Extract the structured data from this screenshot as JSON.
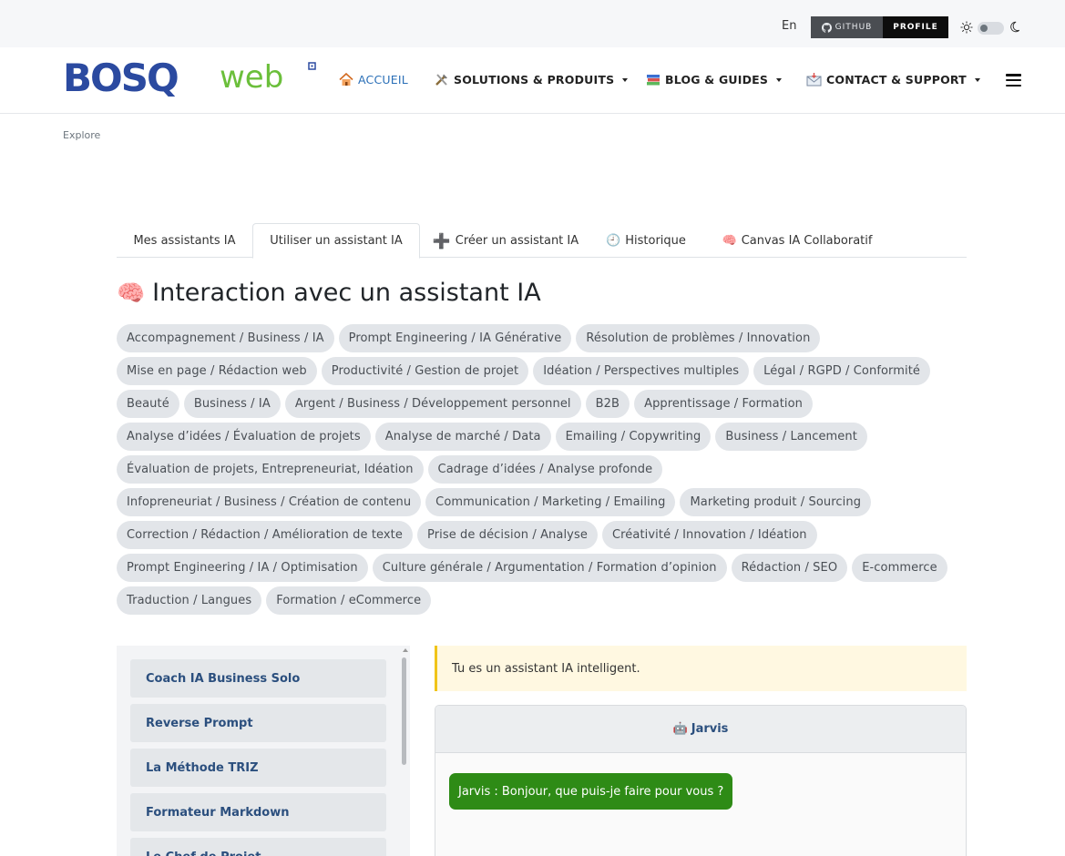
{
  "topbar": {
    "language": "En",
    "github_label": "GITHUB",
    "profile_label": "PROFILE"
  },
  "logo": {
    "text_left": "BOSQ",
    "text_right": "web"
  },
  "nav": {
    "items": [
      {
        "label": "ACCUEIL",
        "icon": "house-icon"
      },
      {
        "label": "SOLUTIONS & PRODUITS",
        "icon": "tools-icon"
      },
      {
        "label": "BLOG & GUIDES",
        "icon": "books-icon"
      },
      {
        "label": "CONTACT & SUPPORT",
        "icon": "envelope-icon"
      }
    ]
  },
  "breadcrumb": "Explore",
  "tabs": [
    {
      "label": "Mes assistants IA"
    },
    {
      "label": "Utiliser un assistant IA"
    },
    {
      "label": "Créer un assistant IA",
      "icon": "➕"
    },
    {
      "label": "Historique",
      "icon": "🕘"
    },
    {
      "label": "Canvas IA Collaboratif",
      "icon": "🧠"
    }
  ],
  "title": {
    "icon": "🧠",
    "text": "Interaction avec un assistant IA"
  },
  "tags": [
    [
      "Accompagnement / Business / IA",
      "Prompt Engineering / IA Générative",
      "Résolution de problèmes / Innovation"
    ],
    [
      "Mise en page / Rédaction web",
      "Productivité / Gestion de projet",
      "Idéation / Perspectives multiples",
      "Légal / RGPD / Conformité"
    ],
    [
      "Beauté",
      "Business / IA",
      "Argent / Business / Développement personnel",
      "B2B",
      "Apprentissage / Formation"
    ],
    [
      "Analyse d’idées / Évaluation de projets",
      "Analyse de marché / Data",
      "Emailing / Copywriting",
      "Business / Lancement"
    ],
    [
      "Évaluation de projets, Entrepreneuriat, Idéation",
      "Cadrage d’idées / Analyse profonde"
    ],
    [
      "Infopreneuriat / Business / Création de contenu",
      "Communication / Marketing / Emailing",
      "Marketing produit / Sourcing"
    ],
    [
      "Correction / Rédaction / Amélioration de texte",
      "Prise de décision / Analyse",
      "Créativité / Innovation / Idéation"
    ],
    [
      "Prompt Engineering / IA / Optimisation",
      "Culture générale / Argumentation / Formation d’opinion",
      "Rédaction / SEO",
      "E-commerce"
    ],
    [
      "Traduction / Langues",
      "Formation / eCommerce"
    ]
  ],
  "assistants": [
    "Coach IA Business Solo",
    "Reverse Prompt",
    "La Méthode TRIZ",
    "Formateur Markdown",
    "Le Chef de Projet"
  ],
  "chat": {
    "system_prompt": "Tu es un assistant IA intelligent.",
    "bot_icon": "🤖",
    "bot_name": "Jarvis",
    "messages": [
      {
        "text": "Jarvis : Bonjour, que puis-je faire pour vous ?"
      }
    ]
  },
  "colors": {
    "accent_blue": "#2a6fb7",
    "brand_blue": "#2b4aa0",
    "brand_green": "#6bbf3b",
    "bot_bubble": "#2e8b16",
    "tag_bg": "#e2e5e9"
  }
}
